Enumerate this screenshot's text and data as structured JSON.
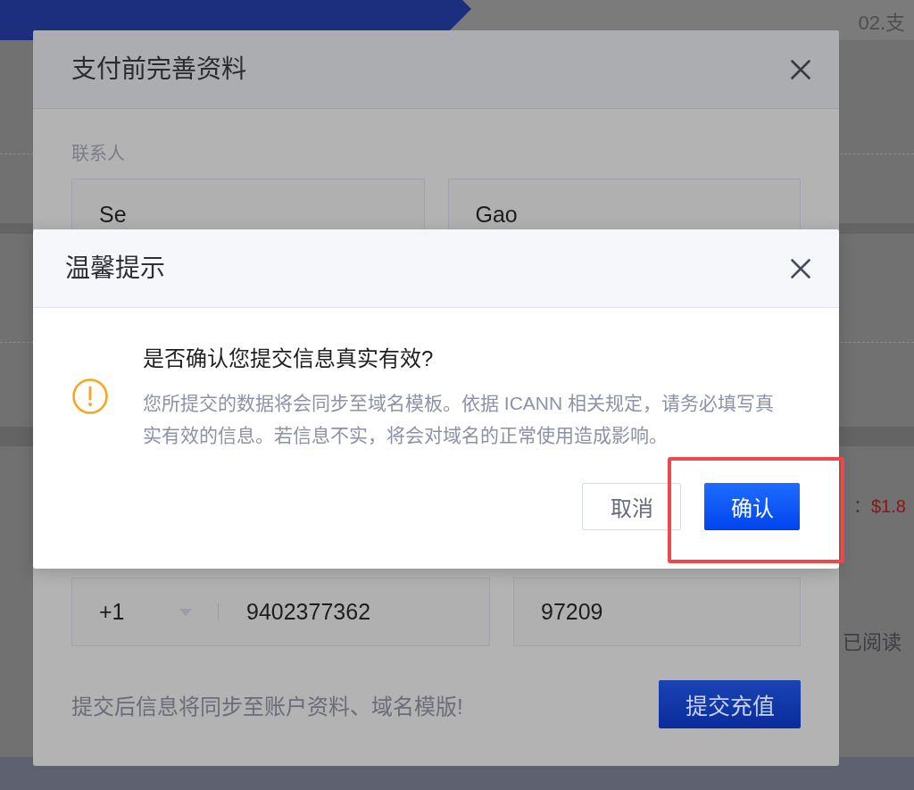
{
  "background_page": {
    "steps": [
      {
        "selected": true
      },
      {
        "label": "02.支",
        "selected": false
      }
    ],
    "amount_label": "：",
    "amount_value": "$1.8",
    "agreement_text": "已阅读"
  },
  "form_dialog": {
    "title": "支付前完善资料",
    "contact_label": "联系人",
    "first_name": "Se",
    "last_name": "Gao",
    "country_code": "+1",
    "phone": "9402377362",
    "postal_code": "97209",
    "note": "提交后信息将同步至账户资料、域名模版!",
    "submit_button": "提交充值"
  },
  "alert_dialog": {
    "title": "温馨提示",
    "heading": "是否确认您提交信息真实有效?",
    "message": "您所提交的数据将会同步至域名模板。依据 ICANN 相关规定，请务必填写真实有效的信息。若信息不实，将会对域名的正常使用造成影响。",
    "buttons": [
      {
        "label": "取消",
        "kind": "secondary",
        "highlighted": false
      },
      {
        "label": "确认",
        "kind": "primary",
        "highlighted": true
      }
    ]
  }
}
